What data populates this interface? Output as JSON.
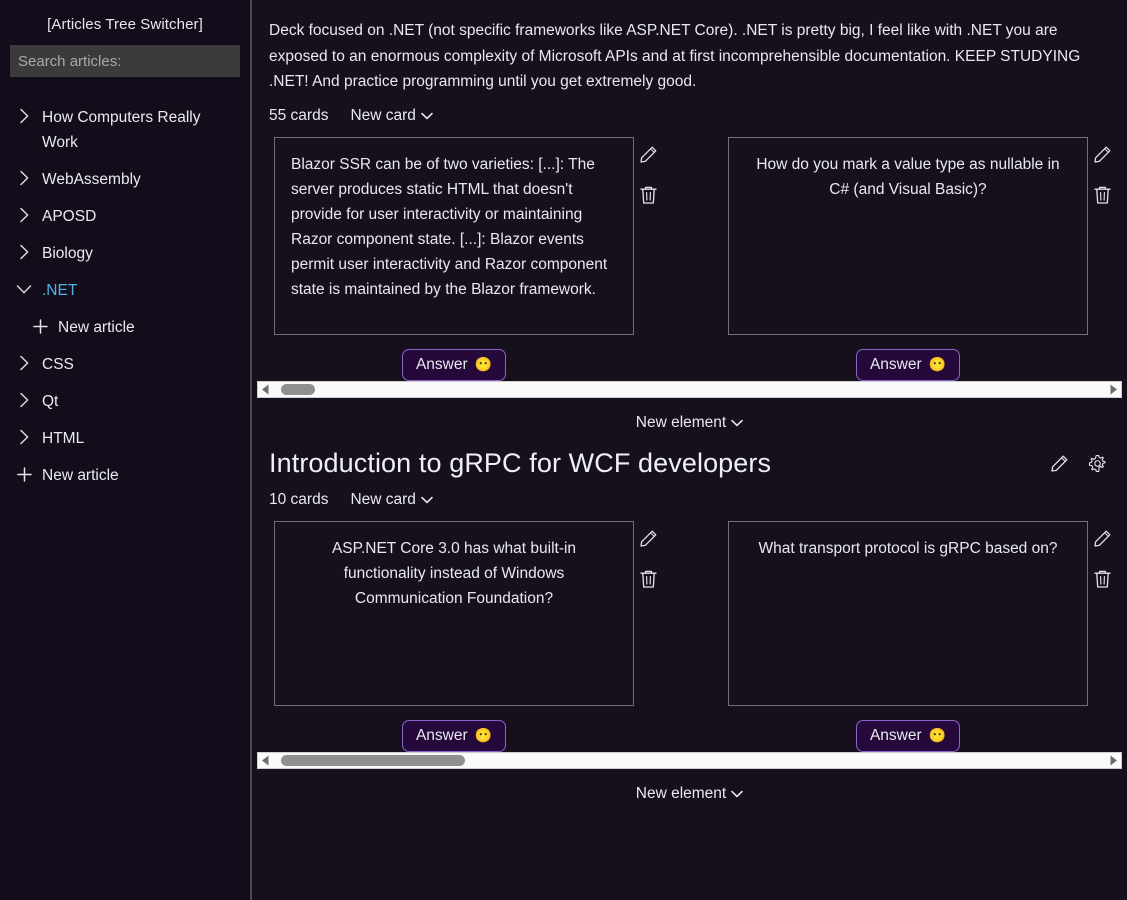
{
  "sidebar": {
    "title": "[Articles Tree Switcher]",
    "search": {
      "placeholder": "Search articles:",
      "value": ""
    },
    "items": [
      {
        "label": "How Computers Really Work",
        "icon": "chevron-right-icon",
        "state": "collapsed",
        "selected": false,
        "child": false
      },
      {
        "label": "WebAssembly",
        "icon": "chevron-right-icon",
        "state": "collapsed",
        "selected": false,
        "child": false
      },
      {
        "label": "APOSD",
        "icon": "chevron-right-icon",
        "state": "collapsed",
        "selected": false,
        "child": false
      },
      {
        "label": "Biology",
        "icon": "chevron-right-icon",
        "state": "collapsed",
        "selected": false,
        "child": false
      },
      {
        "label": ".NET",
        "icon": "chevron-down-icon",
        "state": "expanded",
        "selected": true,
        "child": false
      },
      {
        "label": "New article",
        "icon": "plus-icon",
        "state": "action",
        "selected": false,
        "child": true
      },
      {
        "label": "CSS",
        "icon": "chevron-right-icon",
        "state": "collapsed",
        "selected": false,
        "child": false
      },
      {
        "label": "Qt",
        "icon": "chevron-right-icon",
        "state": "collapsed",
        "selected": false,
        "child": false
      },
      {
        "label": "HTML",
        "icon": "chevron-right-icon",
        "state": "collapsed",
        "selected": false,
        "child": false
      },
      {
        "label": "New article",
        "icon": "plus-icon",
        "state": "action",
        "selected": false,
        "child": false
      }
    ],
    "selected_color": "#4fb3e8"
  },
  "main": {
    "deck_description": "Deck focused on .NET (not specific frameworks like ASP.NET Core). .NET is pretty big, I feel like with .NET you are exposed to an enormous complexity of Microsoft APIs and at first incomprehensible documentation. KEEP STUDYING .NET! And practice programming until you get extremely good.",
    "section_one": {
      "cards_count": "55 cards",
      "new_card_label": "New card",
      "cards": [
        {
          "text": "Blazor SSR can be of two varieties: [...]: The server produces static HTML that doesn't provide for user interactivity or maintaining Razor component state. [...]: Blazor events permit user interactivity and Razor component state is maintained by the Blazor framework.",
          "align": "left",
          "answer_label": "Answer",
          "answer_emoji": "😶",
          "edit_icon": "pencil-icon",
          "delete_icon": "trash-icon"
        },
        {
          "text": "How do you mark a value type as nullable in C# (and Visual Basic)?",
          "align": "center",
          "answer_label": "Answer",
          "answer_emoji": "😶",
          "edit_icon": "pencil-icon",
          "delete_icon": "trash-icon"
        }
      ],
      "scrollbar": {
        "thumb_left_pct": 1,
        "thumb_width_pct": 4
      },
      "new_element_label": "New element"
    },
    "section_two": {
      "deck_title": "Introduction to gRPC for WCF developers",
      "edit_icon": "pencil-icon",
      "settings_icon": "gear-icon",
      "cards_count": "10 cards",
      "new_card_label": "New card",
      "cards": [
        {
          "text": "ASP.NET Core 3.0 has what built-in functionality instead of Windows Communication Foundation?",
          "align": "center",
          "answer_label": "Answer",
          "answer_emoji": "😶",
          "edit_icon": "pencil-icon",
          "delete_icon": "trash-icon"
        },
        {
          "text": "What transport protocol is gRPC based on?",
          "align": "center",
          "answer_label": "Answer",
          "answer_emoji": "😶",
          "edit_icon": "pencil-icon",
          "delete_icon": "trash-icon"
        }
      ],
      "scrollbar": {
        "thumb_left_pct": 1,
        "thumb_width_pct": 22
      },
      "new_element_label": "New element"
    }
  },
  "colors": {
    "background": "#16101d",
    "sidebar_background": "#130d1b",
    "accent_blue": "#4fb3e8",
    "answer_button_bg": "#25093a",
    "answer_button_border": "#8a64c8",
    "card_border": "#6f6f74",
    "text": "#e9e9ed"
  }
}
